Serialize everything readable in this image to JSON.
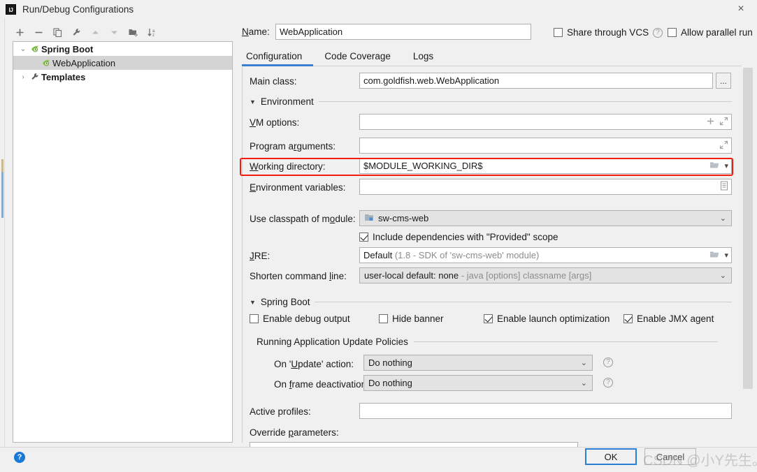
{
  "window": {
    "title": "Run/Debug Configurations",
    "app_icon": "intellij-idea-icon",
    "close_icon": "×"
  },
  "left_toolbar": {
    "buttons": [
      {
        "name": "add-configuration-button",
        "icon": "plus-icon",
        "tip": "Add New Configuration"
      },
      {
        "name": "remove-configuration-button",
        "icon": "minus-icon",
        "tip": "Remove Configuration"
      },
      {
        "name": "copy-configuration-button",
        "icon": "copy-icon",
        "tip": "Copy Configuration"
      },
      {
        "name": "edit-templates-button",
        "icon": "wrench-icon",
        "tip": "Edit Templates"
      },
      {
        "name": "move-up-button",
        "icon": "arrow-up-icon",
        "tip": "Move Up"
      },
      {
        "name": "move-down-button",
        "icon": "arrow-down-icon",
        "tip": "Move Down"
      },
      {
        "name": "new-folder-button",
        "icon": "folder-add-icon",
        "tip": "Create New Folder"
      },
      {
        "name": "sort-configurations-button",
        "icon": "sort-alpha-icon",
        "tip": "Sort Configurations"
      }
    ]
  },
  "tree": {
    "items": [
      {
        "label": "Spring Boot",
        "twisty": "⌄",
        "icon": "spring-boot-icon",
        "indent": 0,
        "bold": true,
        "selected": false
      },
      {
        "label": "WebApplication",
        "twisty": "",
        "icon": "spring-boot-icon",
        "indent": 1,
        "bold": false,
        "selected": true
      },
      {
        "label": "Templates",
        "twisty": "›",
        "icon": "wrench-icon",
        "indent": 0,
        "bold": true,
        "selected": false
      }
    ]
  },
  "header": {
    "name_label": "Name:",
    "name_value": "WebApplication",
    "name_placeholder": "",
    "share_through_vcs": {
      "label": "Share through VCS",
      "checked": false
    },
    "allow_parallel_run": {
      "label": "Allow parallel run",
      "checked": false
    },
    "help_icon": "?"
  },
  "tabs": [
    {
      "label": "Configuration",
      "active": true
    },
    {
      "label": "Code Coverage",
      "active": false
    },
    {
      "label": "Logs",
      "active": false
    }
  ],
  "form": {
    "main_class": {
      "label": "Main class:",
      "value": "com.goldfish.web.WebApplication",
      "browse_label": "...",
      "browse_icon": "ellipsis-icon"
    },
    "environment_section": "Environment",
    "vm_options": {
      "label": "VM options:",
      "value": "",
      "adorn_icons": [
        "plus-icon",
        "expand-icon"
      ]
    },
    "program_arguments": {
      "label": "Program arguments:",
      "value": "",
      "adorn_icons": [
        "expand-icon"
      ]
    },
    "working_directory": {
      "label": "Working directory:",
      "value": "$MODULE_WORKING_DIR$",
      "adorn_icons": [
        "folder-icon",
        "chevron-down-icon"
      ],
      "highlight_color": "#f41c10"
    },
    "environment_variables": {
      "label": "Environment variables:",
      "value": "",
      "adorn_icons": [
        "table-edit-icon"
      ]
    },
    "use_classpath_of_module": {
      "label": "Use classpath of module:",
      "value": "sw-cms-web",
      "icon": "module-icon",
      "chevron": "⌄"
    },
    "include_provided_scope": {
      "label": "Include dependencies with \"Provided\" scope",
      "checked": true
    },
    "jre": {
      "label": "JRE:",
      "value": "Default",
      "value_dim": "(1.8 - SDK of 'sw-cms-web' module)",
      "adorn_icons": [
        "folder-icon",
        "chevron-down-icon"
      ]
    },
    "shorten_command_line": {
      "label": "Shorten command line:",
      "value": "user-local default: none",
      "value_dim": "- java [options] classname [args]",
      "chevron": "⌄"
    },
    "spring_boot_section": "Spring Boot",
    "spring_boot_checkboxes": [
      {
        "label": "Enable debug output",
        "checked": false,
        "name": "enable-debug-output-checkbox"
      },
      {
        "label": "Hide banner",
        "checked": false,
        "name": "hide-banner-checkbox"
      },
      {
        "label": "Enable launch optimization",
        "checked": true,
        "name": "enable-launch-optimization-checkbox"
      },
      {
        "label": "Enable JMX agent",
        "checked": true,
        "name": "enable-jmx-agent-checkbox"
      }
    ],
    "update_policies_section": "Running Application Update Policies",
    "on_update_action": {
      "label": "On 'Update' action:",
      "value": "Do nothing",
      "chevron": "⌄",
      "help": "?"
    },
    "on_frame_deactivation": {
      "label": "On frame deactivation:",
      "value": "Do nothing",
      "chevron": "⌄",
      "help": "?"
    },
    "active_profiles": {
      "label": "Active profiles:",
      "value": "",
      "placeholder": ""
    },
    "override_parameters": {
      "label": "Override parameters:"
    }
  },
  "footer": {
    "help_icon": "?",
    "ok_label": "OK",
    "cancel_label": "Cancel",
    "watermark": "CSDN @小Y先生。"
  }
}
